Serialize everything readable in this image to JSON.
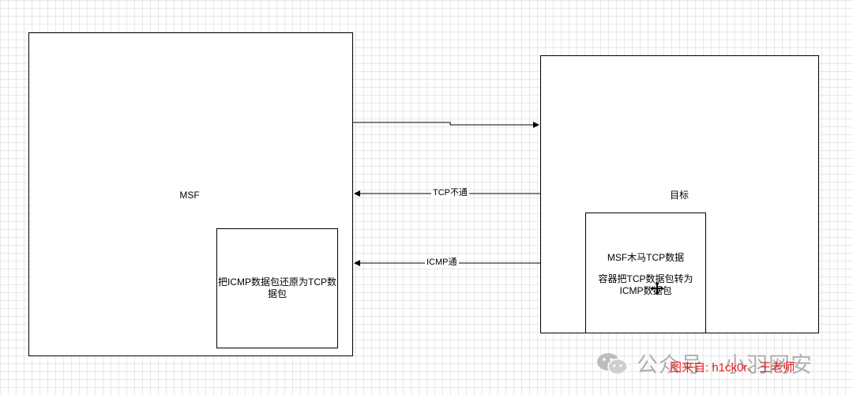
{
  "nodes": {
    "msf": {
      "label": "MSF"
    },
    "target": {
      "label": "目标"
    },
    "msf_inner": {
      "label": "把ICMP数据包还原为TCP数据包"
    },
    "trojan": {
      "line1": "MSF木马TCP数据",
      "line2": "容器把TCP数据包转为ICMP数据包"
    }
  },
  "edges": {
    "tcp_blocked": "TCP不通",
    "icmp_ok": "ICMP通"
  },
  "watermark": {
    "account": "公众号 · 小羽网安",
    "credit": "图来自: h1ck0r、王老师"
  },
  "colors": {
    "credit": "#e02020",
    "watermark": "#b0b0b0"
  }
}
